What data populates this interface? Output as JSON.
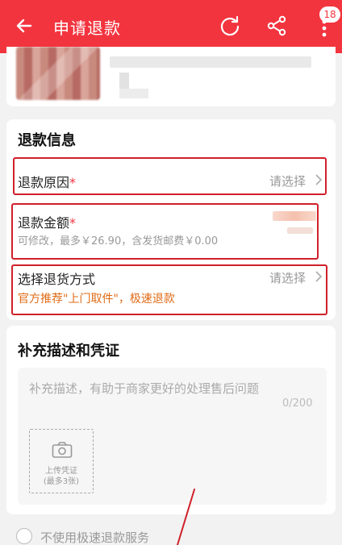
{
  "header": {
    "title": "申请退款",
    "badge": "18",
    "bg_color": "#f2343f",
    "icons": [
      "back-arrow-icon",
      "refresh-icon",
      "share-icon",
      "more-vertical-icon"
    ]
  },
  "refund_info": {
    "title": "退款信息",
    "reason": {
      "label": "退款原因",
      "required_mark": "*",
      "value": "请选择"
    },
    "amount": {
      "label": "退款金额",
      "required_mark": "*",
      "hint": "可修改，最多￥26.90，含发货邮费￥0.00"
    },
    "return_method": {
      "label": "选择退货方式",
      "value": "请选择",
      "promo": "官方推荐\"上门取件\"，极速退款"
    }
  },
  "supplement": {
    "title": "补充描述和凭证",
    "placeholder": "补充描述，有助于商家更好的处理售后问题",
    "counter": "0/200",
    "upload_line1": "上传凭证",
    "upload_line2": "(最多3张)"
  },
  "options": {
    "no_fast_refund": "不使用极速退款服务"
  },
  "colors": {
    "accent": "#f2343f",
    "promo": "#e06a14",
    "highlight_box": "#d0202a"
  }
}
